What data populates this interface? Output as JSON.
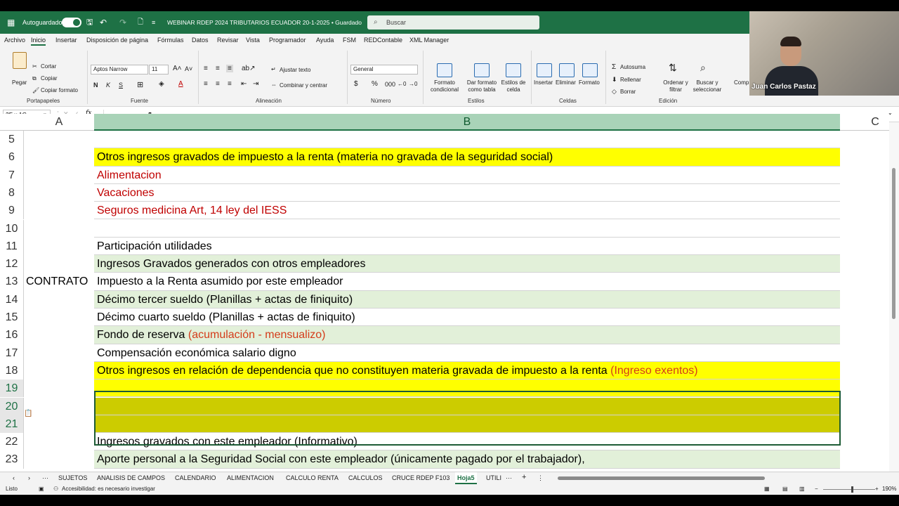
{
  "titlebar": {
    "autosave_label": "Autoguardado",
    "filename": "WEBINAR RDEP 2024 TRIBUTARIOS ECUADOR 20-1-2025 • Guardado",
    "search_placeholder": "Buscar"
  },
  "menu": [
    "Archivo",
    "Inicio",
    "Insertar",
    "Disposición de página",
    "Fórmulas",
    "Datos",
    "Revisar",
    "Vista",
    "Programador",
    "Ayuda",
    "FSM",
    "REDContable",
    "XML Manager"
  ],
  "ribbon": {
    "clipboard": {
      "paste": "Pegar",
      "cut": "Cortar",
      "copy": "Copiar",
      "format_painter": "Copiar formato",
      "group": "Portapapeles"
    },
    "font": {
      "name": "Aptos Narrow",
      "size": "11",
      "bold": "N",
      "italic": "K",
      "underline": "S",
      "group": "Fuente"
    },
    "alignment": {
      "wrap": "Ajustar texto",
      "merge": "Combinar y centrar",
      "group": "Alineación"
    },
    "number": {
      "format": "General",
      "group": "Número"
    },
    "styles": {
      "conditional": "Formato condicional",
      "table": "Dar formato como tabla",
      "cell_styles": "Estilos de celda",
      "group": "Estilos"
    },
    "cells": {
      "insert": "Insertar",
      "delete": "Eliminar",
      "format": "Formato",
      "group": "Celdas"
    },
    "editing": {
      "autosum": "Autosuma",
      "fill": "Rellenar",
      "clear": "Borrar",
      "sort": "Ordenar y filtrar",
      "find": "Buscar y seleccionar",
      "group": "Edición",
      "extra": "Comp"
    }
  },
  "formula_bar": {
    "name_box": "3F x 1C",
    "fx": "fx"
  },
  "columns": {
    "A": "A",
    "B": "B",
    "C": "C"
  },
  "rows": [
    {
      "num": "5",
      "a": "",
      "b": [],
      "fill": "white"
    },
    {
      "num": "6",
      "a": "",
      "b": [
        {
          "t": "Otros ingresos gravados de impuesto a la renta (materia no gravada de la seguridad social)",
          "c": "black"
        }
      ],
      "fill": "yellow"
    },
    {
      "num": "7",
      "a": "",
      "b": [
        {
          "t": "Alimentacion",
          "c": "red"
        }
      ],
      "fill": "white"
    },
    {
      "num": "8",
      "a": "",
      "b": [
        {
          "t": "Vacaciones",
          "c": "red"
        }
      ],
      "fill": "white"
    },
    {
      "num": "9",
      "a": "",
      "b": [
        {
          "t": "Seguros medicina Art, 14 ley del IESS",
          "c": "red"
        }
      ],
      "fill": "white"
    },
    {
      "num": "10",
      "a": "",
      "b": [],
      "fill": "white"
    },
    {
      "num": "11",
      "a": "",
      "b": [
        {
          "t": "Participación utilidades",
          "c": "black"
        }
      ],
      "fill": "white"
    },
    {
      "num": "12",
      "a": "",
      "b": [
        {
          "t": "Ingresos Gravados generados con otros empleadores",
          "c": "black"
        }
      ],
      "fill": "green"
    },
    {
      "num": "13",
      "a": "CONTRATO",
      "b": [
        {
          "t": "Impuesto a la Renta asumido por este empleador",
          "c": "black"
        }
      ],
      "fill": "white"
    },
    {
      "num": "14",
      "a": "",
      "b": [
        {
          "t": "Décimo tercer sueldo (Planillas + actas de finiquito)",
          "c": "black"
        }
      ],
      "fill": "green"
    },
    {
      "num": "15",
      "a": "",
      "b": [
        {
          "t": "Décimo cuarto sueldo (Planillas + actas de finiquito)",
          "c": "black"
        }
      ],
      "fill": "white"
    },
    {
      "num": "16",
      "a": "",
      "b": [
        {
          "t": "Fondo de reserva ",
          "c": "black"
        },
        {
          "t": "(acumulación - mensualizo)",
          "c": "orange"
        }
      ],
      "fill": "green"
    },
    {
      "num": "17",
      "a": "",
      "b": [
        {
          "t": "Compensación económica salario digno",
          "c": "black"
        }
      ],
      "fill": "white"
    },
    {
      "num": "18",
      "a": "",
      "b": [
        {
          "t": "Otros ingresos en relación de dependencia que no constituyen materia gravada de impuesto a la renta ",
          "c": "black"
        },
        {
          "t": "(Ingreso exentos)",
          "c": "orange"
        }
      ],
      "fill": "yellow"
    },
    {
      "num": "19",
      "a": "",
      "b": [],
      "fill": "yellow",
      "sel": true
    },
    {
      "num": "20",
      "a": "",
      "b": [],
      "fill": "olive",
      "sel": true
    },
    {
      "num": "21",
      "a": "",
      "b": [],
      "fill": "olive",
      "sel": true
    },
    {
      "num": "22",
      "a": "",
      "b": [
        {
          "t": "Ingresos gravados con este empleador (Informativo)",
          "c": "black"
        }
      ],
      "fill": "white"
    },
    {
      "num": "23",
      "a": "",
      "b": [
        {
          "t": "Aporte personal a la Seguridad Social con este empleador (únicamente pagado por el trabajador),",
          "c": "black"
        }
      ],
      "fill": "green"
    }
  ],
  "fills": {
    "white": "#ffffff",
    "yellow": "#ffff00",
    "green": "#e2f0d9",
    "olive": "#cccc00"
  },
  "text_colors": {
    "black": "#000000",
    "red": "#c00000",
    "orange": "#d43c1a"
  },
  "sheet_tabs": [
    "SUJETOS",
    "ANALISIS DE CAMPOS",
    "CALENDARIO",
    "ALIMENTACION",
    "CALCULO RENTA",
    "CALCULOS",
    "CRUCE RDEP F103",
    "Hoja5",
    "UTILI"
  ],
  "active_tab": "Hoja5",
  "status": {
    "ready": "Listo",
    "accessibility": "Accesibilidad: es necesario investigar",
    "zoom": "190%"
  },
  "webcam": {
    "name": "Juan Carlos Pastaz"
  }
}
